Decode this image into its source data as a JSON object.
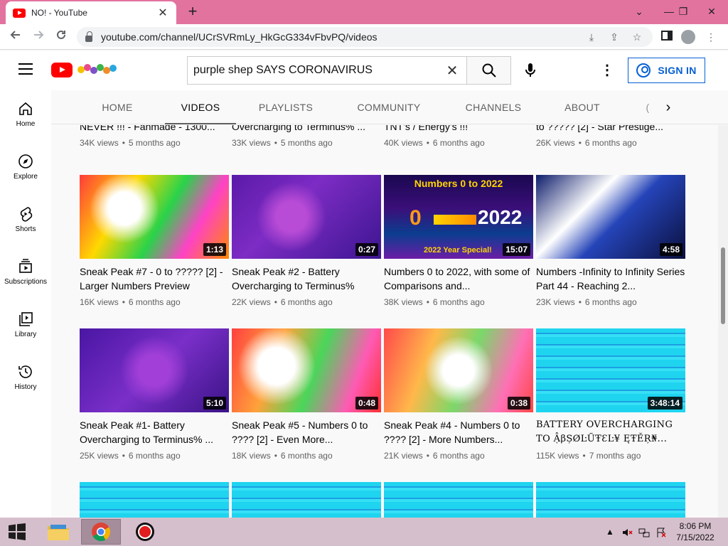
{
  "browser": {
    "tab_title": "NO! - YouTube",
    "tab_close": "✕",
    "new_tab": "+",
    "url": "youtube.com/channel/UCrSVRmLy_HkGcG334vFbvPQ/videos",
    "window_controls": {
      "minimize": "⌄",
      "min": "—",
      "restore": "❐",
      "close": "✕"
    }
  },
  "youtube": {
    "search_query": "purple shep SAYS CORONAVIRUS",
    "clear_icon": "✕",
    "more_icon": "⋮",
    "signin_label": "SIGN IN",
    "guide": [
      {
        "label": "Home",
        "icon": "home-icon"
      },
      {
        "label": "Explore",
        "icon": "compass-icon"
      },
      {
        "label": "Shorts",
        "icon": "shorts-icon"
      },
      {
        "label": "Subscriptions",
        "icon": "subscriptions-icon"
      },
      {
        "label": "Library",
        "icon": "library-icon"
      },
      {
        "label": "History",
        "icon": "history-icon"
      }
    ],
    "tabs": [
      "HOME",
      "VIDEOS",
      "PLAYLISTS",
      "COMMUNITY",
      "CHANNELS",
      "ABOUT"
    ],
    "tabs_partial": "(",
    "active_tab": "VIDEOS",
    "top_row": [
      {
        "title": "NEVER !!! - Fanmade - 1300...",
        "views": "34K views",
        "age": "5 months ago"
      },
      {
        "title": "Overcharging to Terminus% ...",
        "views": "33K views",
        "age": "5 months ago"
      },
      {
        "title": "TNT's / Energy's !!!",
        "views": "40K views",
        "age": "6 months ago"
      },
      {
        "title": "to ????? [2] - Star Prestige...",
        "views": "26K views",
        "age": "6 months ago"
      }
    ],
    "rows": [
      [
        {
          "title": "Sneak Peak #7 - 0 to ????? [2] - Larger Numbers Preview",
          "views": "16K views",
          "age": "6 months ago",
          "duration": "1:13",
          "thumb_style": "rainbow"
        },
        {
          "title": "Sneak Peak #2 - Battery Overcharging to Terminus%",
          "views": "22K views",
          "age": "6 months ago",
          "duration": "0:27",
          "thumb_style": "purple"
        },
        {
          "title": "Numbers 0 to 2022, with some of Comparisons and...",
          "views": "38K views",
          "age": "6 months ago",
          "duration": "15:07",
          "thumb_style": "neon",
          "thumb_text": {
            "top": "Numbers 0 to 2022",
            "left": "0",
            "right": "2022",
            "bottom": "2022 Year Special!"
          }
        },
        {
          "title": "Numbers -Infinity to Infinity Series Part 44 - Reaching 2...",
          "views": "23K views",
          "age": "6 months ago",
          "duration": "4:58",
          "thumb_style": "collage"
        }
      ],
      [
        {
          "title": "Sneak Peak #1- Battery Overcharging to Terminus% ...",
          "views": "25K views",
          "age": "6 months ago",
          "duration": "5:10",
          "thumb_style": "purple2"
        },
        {
          "title": "Sneak Peak #5 - Numbers 0 to ???? [2] - Even More...",
          "views": "18K views",
          "age": "6 months ago",
          "duration": "0:48",
          "thumb_style": "rainbow2"
        },
        {
          "title": "Sneak Peak #4 - Numbers 0 to ???? [2] - More Numbers...",
          "views": "21K views",
          "age": "6 months ago",
          "duration": "0:38",
          "thumb_style": "rainbow3"
        },
        {
          "title": "BATTERY OVERCHARGING TO ẬβȘØĿŨŦƐĿ¥ ĘŦĚŖ₦...",
          "views": "115K views",
          "age": "7 months ago",
          "duration": "3:48:14",
          "thumb_style": "cyan",
          "serif": true
        }
      ]
    ],
    "bottom_row_thumbs": [
      "cyan",
      "cyan",
      "cyan",
      "cyan"
    ],
    "meta_separator": "•"
  },
  "taskbar": {
    "time": "8:06 PM",
    "date": "7/15/2022",
    "tray_up": "▲"
  },
  "colors": {
    "tabbar": "#e2739f",
    "youtube_red": "#ff0000",
    "signin_blue": "#065fd4",
    "taskbar": "#d6bfcc"
  }
}
